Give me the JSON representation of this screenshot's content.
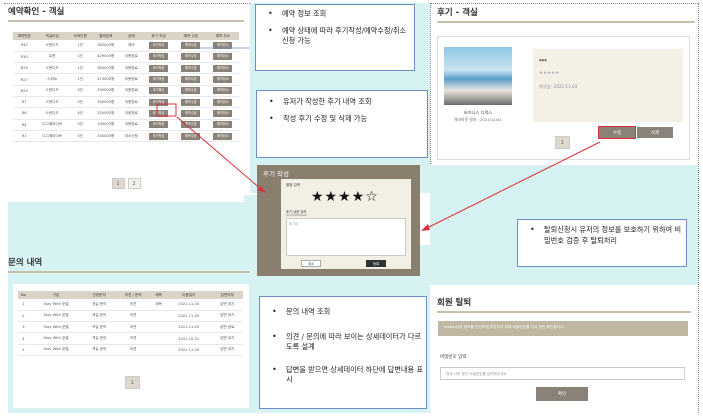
{
  "reservation": {
    "title": "예약확인 - 객실",
    "headers": [
      "예약번호",
      "객실타입",
      "숙박인원",
      "결제금액",
      "상태",
      "후기 작성",
      "예약 수정",
      "예약 취소"
    ],
    "rows": [
      [
        "R32",
        "스탠다드",
        "1인",
        "363000원",
        "예약",
        "후기작성",
        "예약수정",
        "예약취소"
      ],
      [
        "R30",
        "트윈",
        "1인",
        "429000원",
        "이용완료",
        "후기작성",
        "예약수정",
        "예약취소"
      ],
      [
        "R29",
        "스탠다드",
        "1인",
        "363000원",
        "이용완료",
        "후기작성",
        "예약수정",
        "예약취소"
      ],
      [
        "R27",
        "스위트",
        "1인",
        "473000원",
        "이용완료",
        "후기작성",
        "예약수정",
        "예약취소"
      ],
      [
        "R24",
        "스탠다드",
        "3인",
        "330000원",
        "이용완료",
        "후기확인",
        "예약수정",
        "예약취소"
      ],
      [
        "R7",
        "스탠다드",
        "3인",
        "330000원",
        "이용완료",
        "후기작성",
        "예약수정",
        "예약취소"
      ],
      [
        "R6",
        "스탠다드",
        "4인",
        "320000원",
        "이용완료",
        "후기작성",
        "예약수정",
        "예약취소"
      ],
      [
        "R4",
        "디그페라디브",
        "3인",
        "330000원",
        "이용완료",
        "후기작성",
        "예약수정",
        "예약취소"
      ],
      [
        "R1",
        "디그페라디브",
        "3인",
        "330000원",
        "취소신청",
        "후기작성",
        "예약수정",
        "예약취소"
      ]
    ],
    "pages": [
      "1",
      "2"
    ]
  },
  "note1": [
    "예약 정보 조회",
    "예약 상태에 따라 후기작성/예약수정/취소 신청 가능"
  ],
  "note2": [
    "유저가 작성한 후기 내역 조회",
    "작성 후기 수정 및 삭제 가능"
  ],
  "note3": [
    "문의 내역 조회",
    "의견 / 문의에 따라 보이는 상세데이터가 다르도록 설계",
    "답변을 받으면 상세데이터 하단에 답변내용 표시"
  ],
  "note4": [
    "탈퇴신청시 유저의 정보를 보호하기 위하여 비밀번호 검증 후 탈퇴처리"
  ],
  "review": {
    "title": "후기 - 객실",
    "room": "비즈니스 디럭스",
    "checkout": "체크아웃 일자 : 2021/11/01",
    "author": "***",
    "stars_text": "★★★★★",
    "date": "작성일 : 2021-11-03",
    "edit": "수정",
    "delete": "삭제",
    "page": "1"
  },
  "popup": {
    "title": "후기 작성",
    "rating_label": "별점 입력",
    "stars": "★★★★☆",
    "text_label": "후기 내용 입력",
    "text_hint": "(0/1000bytes)",
    "placeholder": "후기내",
    "cancel": "취소",
    "submit": "등록"
  },
  "inquiry": {
    "title": "문의 내역",
    "headers": [
      "No",
      "구분",
      "관련문의",
      "의견 / 문의",
      "제목",
      "이용일자",
      "답변여부"
    ],
    "rows": [
      [
        "1",
        "Stay With 호텔",
        "객실 문의",
        "의견",
        "제목",
        "2021-11-03",
        "답변 대기"
      ],
      [
        "2",
        "Stay With 호텔",
        "객실 문의",
        "의견",
        "",
        "2021-11-03",
        "답변 대기"
      ],
      [
        "3",
        "Stay With 호텔",
        "객실 문의",
        "의견",
        "",
        "2021-11-03",
        "답변 완료"
      ],
      [
        "4",
        "Stay With 호텔",
        "객실 문의",
        "의견",
        "",
        "2021-10-31",
        "답변 대기"
      ],
      [
        "5",
        "Stay With 호텔",
        "객실 문의",
        "의견",
        "",
        "2021-11-03",
        "답변 대기"
      ]
    ],
    "page": "1"
  },
  "withdraw": {
    "title": "회원 탈퇴",
    "notice": "testdu님의 정보를 안전하게 보호하기 위해 비밀번호를 다시 한번 확인합니다.",
    "pw_label": "비밀번호 입력",
    "pw_placeholder": "현재 사용 중인 비밀번호를 입력해주세요",
    "confirm": "확인"
  },
  "colors": {
    "accent": "#c8c0a8",
    "button": "#8a8178",
    "note_border": "#6b8fc6",
    "arrow": "#d9303a",
    "popup_bg": "#e8e2c9"
  }
}
